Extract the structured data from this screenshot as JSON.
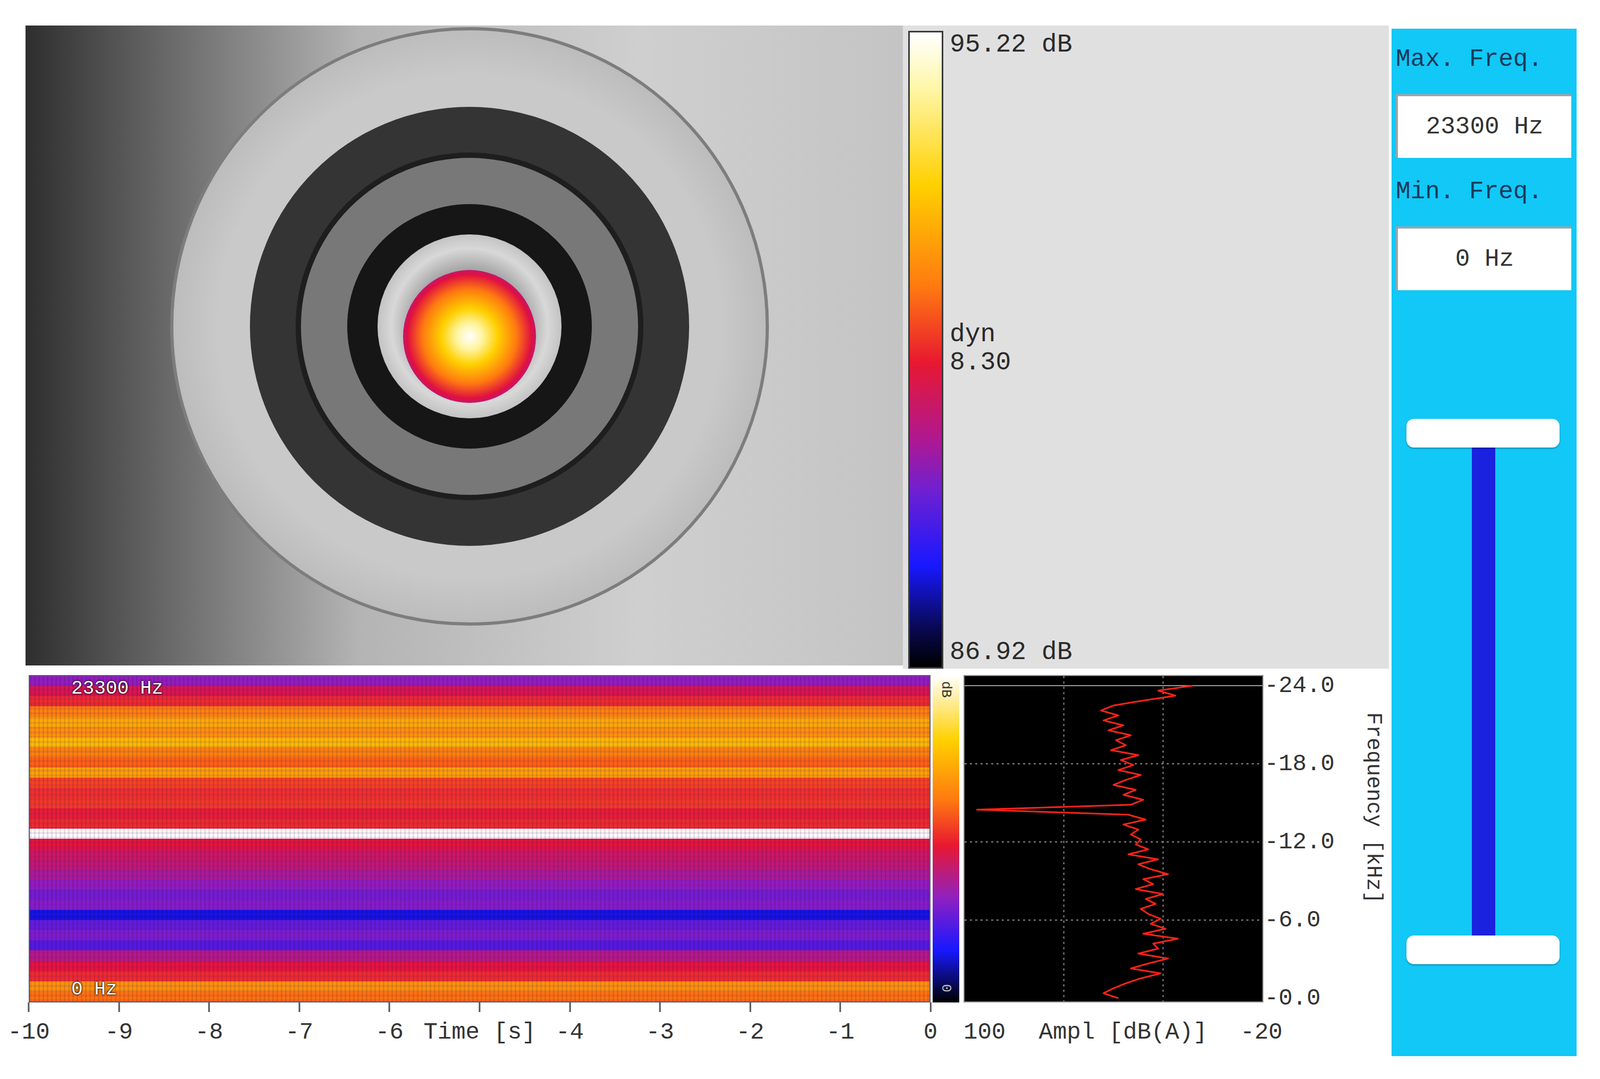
{
  "color_scale": {
    "max": "95.22 dB",
    "dyn_label": "dyn",
    "dyn": "8.30",
    "min": "86.92 dB"
  },
  "frequency_filter": {
    "max_label": "Max. Freq.",
    "max_value": "23300 Hz",
    "min_label": "Min. Freq.",
    "min_value": "0 Hz",
    "max_level": 0.97,
    "min_level": 0.0
  },
  "spectrogram": {
    "top_label": "23300 Hz",
    "bottom_label": "0 Hz",
    "scale_top": "dB",
    "scale_bottom": "0",
    "bands": [
      0.36,
      0.48,
      0.55,
      0.7,
      0.75,
      0.72,
      0.77,
      0.7,
      0.66,
      0.74,
      0.6,
      0.56,
      0.58,
      0.52,
      0.55,
      1.0,
      0.5,
      0.46,
      0.44,
      0.4,
      0.36,
      0.32,
      0.34,
      0.18,
      0.3,
      0.33,
      0.28,
      0.42,
      0.5,
      0.55,
      0.72,
      0.68
    ]
  },
  "time_axis": {
    "labels": [
      "-10",
      "-9",
      "-8",
      "-7",
      "-6",
      "Time [s]",
      "-4",
      "-3",
      "-2",
      "-1",
      "0"
    ]
  },
  "spectrum": {
    "axis_left": "100",
    "axis_title": "Ampl [dB(A)]",
    "axis_right": "-20",
    "values": [
      8,
      22,
      15,
      28,
      40,
      45,
      38,
      44,
      36,
      42,
      33,
      39,
      35,
      41,
      30,
      37,
      32,
      38,
      29,
      35,
      40,
      31,
      36,
      28,
      33,
      95,
      34,
      27,
      36,
      30,
      33,
      29,
      31,
      26,
      34,
      22,
      30,
      25,
      18,
      28,
      24,
      31,
      20,
      27,
      23,
      29,
      26,
      21,
      25,
      19,
      28,
      14,
      24,
      22,
      30,
      18,
      26,
      33,
      21,
      29,
      35,
      40,
      44,
      38
    ]
  },
  "frequency_axis": {
    "title": "Frequency [kHz]",
    "ticks": [
      "-24.0",
      "-18.0",
      "-12.0",
      "-6.0",
      "-0.0"
    ]
  }
}
